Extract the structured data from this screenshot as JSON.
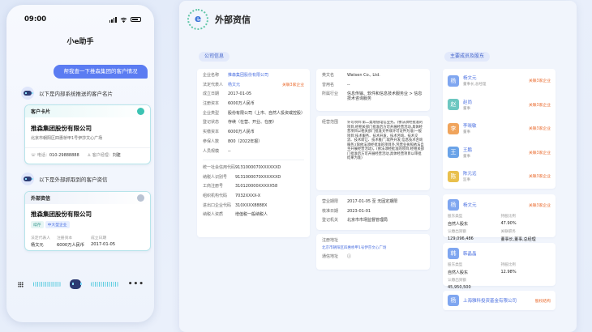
{
  "phone": {
    "time": "09:00",
    "app_title": "小e助手",
    "user_message": "帮我查一下推森集团的客户情况",
    "bot_msg_1": "以下是内部系统推送的客户名片",
    "customer_card": {
      "title": "客户卡片",
      "company": "推森集团股份有限公司",
      "address": "北京市朝阳区四惠桥甲1号伊莎文心广场",
      "phone_label": "电话：",
      "phone": "010-29888888",
      "manager_label": "客户经理：",
      "manager": "刘建"
    },
    "bot_msg_2": "以下是外部抓取到的客户资信",
    "ext_card": {
      "title": "外部资信",
      "company": "推森集团股份有限公司",
      "tags": [
        "续存",
        "中大型企业"
      ],
      "fields": [
        {
          "label": "法定代表人",
          "value": "杨文元"
        },
        {
          "label": "注册资本",
          "value": "6000万人民币"
        },
        {
          "label": "成立日期",
          "value": "2017-01-05"
        }
      ]
    },
    "dots": "•••"
  },
  "panel": {
    "title": "外部资信",
    "sections": {
      "company_info": "公司信息",
      "members": "主要成员及股东"
    },
    "risk_label": "关联3家企业",
    "basic": [
      {
        "k": "企业名称",
        "v": "推森集团股份有限公司",
        "style": "link"
      },
      {
        "k": "法定代表人",
        "v": "杨文元",
        "style": "link"
      },
      {
        "k": "成立日期",
        "v": "2017-01-05",
        "style": ""
      },
      {
        "k": "注册资本",
        "v": "6000万人民币",
        "style": ""
      },
      {
        "k": "企业类型",
        "v": "股份有限公司（上市、自然人投资或控股）",
        "style": ""
      },
      {
        "k": "登记状态",
        "v": "存续（在营、开业、在册）",
        "style": ""
      },
      {
        "k": "实缴资本",
        "v": "6000万人民币",
        "style": ""
      },
      {
        "k": "参保人数",
        "v": "800（2022年报）",
        "style": ""
      },
      {
        "k": "人员规模",
        "v": "--",
        "style": ""
      }
    ],
    "codes": [
      {
        "k": "统一社会信用代码",
        "v": "9131000070XXXXXXD"
      },
      {
        "k": "纳税人识别号",
        "v": "9131000070XXXXXXD"
      },
      {
        "k": "工商注册号",
        "v": "310120000XXXXX58"
      },
      {
        "k": "组织机构代码",
        "v": "7032XXXX-X"
      },
      {
        "k": "进出口企业代码",
        "v": "310XXXX8888X"
      },
      {
        "k": "纳税人资质",
        "v": "增值税一般纳税人"
      }
    ],
    "mid": [
      {
        "k": "英文名",
        "v": "Watsen Co., Ltd."
      },
      {
        "k": "曾用名",
        "v": "--"
      },
      {
        "k": "所属行业",
        "v": "信息传输、软件和信息技术服务业 > 信息技术咨询服务"
      }
    ],
    "scope_label": "经营范围",
    "scope": "许可项目:第二类增值电信业务。(依法须经批准的项目,经相关部门批准后方可开展经营活动,具体经营项目以相关部门批准文件或许可证件为准)一般项目:技术服务、技术开发、技术咨询、技术交流、技术转让、技术推广;软件开发;信息技术咨询服务;(除依法须经批准的项目外,凭营业执照依法自主开展经营活动)。(依法须经批准的项目,经相关部门批准后方可开展经营活动,具体经营项目以审批结果为准)",
    "term": [
      {
        "k": "营业期限",
        "v": "2017-01-05 至 无固定期限"
      },
      {
        "k": "核准日期",
        "v": "2023-01-01"
      },
      {
        "k": "登记机关",
        "v": "北京市市场监督管理局"
      }
    ],
    "reg_addr_label": "注册地址",
    "reg_addr": "北京市朝阳区四惠桥甲1号伊莎文心广场",
    "mail_label": "通信地址",
    "members": [
      {
        "initial": "杨",
        "name": "杨文元",
        "role": "董事长,总经理",
        "color": "#7fa6f0"
      },
      {
        "initial": "赵",
        "name": "赵尚",
        "role": "董事",
        "color": "#6dc7c1"
      },
      {
        "initial": "李",
        "name": "李晓敏",
        "role": "董事",
        "color": "#f0a45c"
      },
      {
        "initial": "王",
        "name": "王鹏",
        "role": "董事",
        "color": "#6aa3e8"
      },
      {
        "initial": "陈",
        "name": "陈元远",
        "role": "监事",
        "color": "#e9c04d"
      }
    ],
    "holders": [
      {
        "initial": "杨",
        "name": "杨文元",
        "risk": "关联3家企业",
        "f": [
          [
            "股东类型",
            "持股比例"
          ],
          [
            "自然人股东",
            "47.90%"
          ],
          [
            "认缴出资额",
            "关联职务"
          ],
          [
            "129,096,486",
            "董事长,董事,总经理"
          ]
        ]
      },
      {
        "initial": "韩",
        "name": "韩晶晶",
        "risk": "",
        "f": [
          [
            "股东类型",
            "持股比例"
          ],
          [
            "自然人股东",
            "12.98%"
          ],
          [
            "认缴出资额",
            ""
          ],
          [
            "45,950,500",
            ""
          ]
        ]
      }
    ],
    "holder_company": {
      "initial": "杨",
      "name": "上海雅科投资基金有限公司",
      "risk": "股权结构"
    }
  }
}
